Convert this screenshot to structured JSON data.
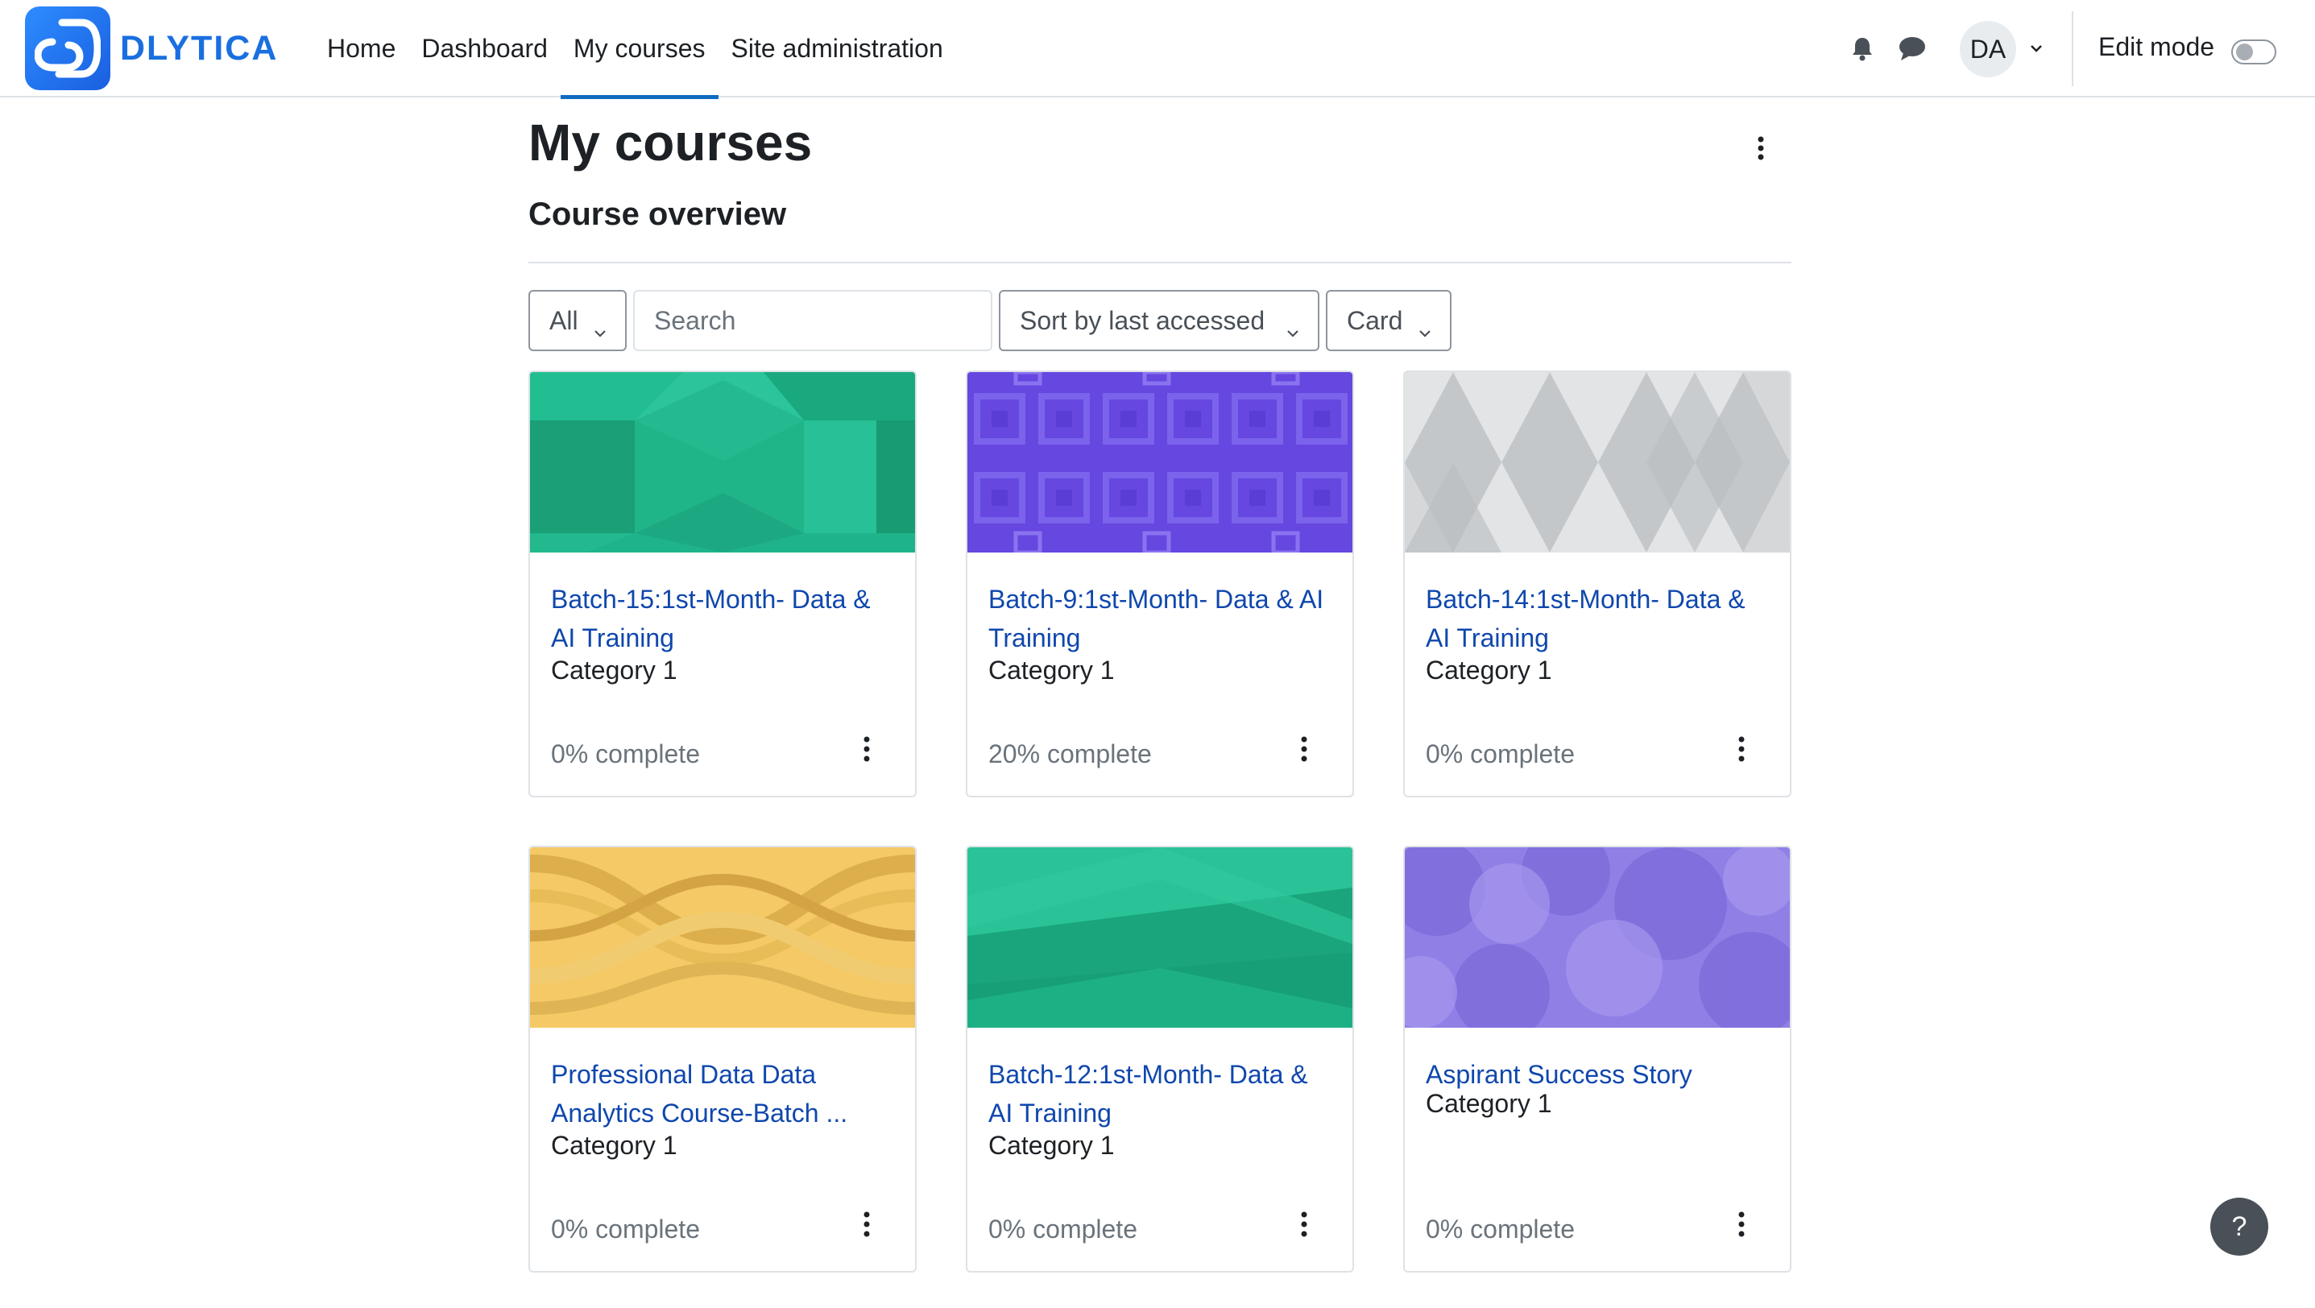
{
  "brand": {
    "name": "DLYTICA",
    "accent": "#1a6fe0"
  },
  "nav": {
    "items": [
      {
        "label": "Home"
      },
      {
        "label": "Dashboard"
      },
      {
        "label": "My courses",
        "active": true
      },
      {
        "label": "Site administration"
      }
    ],
    "icons": [
      "bell-icon",
      "chat-icon"
    ],
    "user_initials": "DA",
    "edit_mode_label": "Edit mode",
    "edit_mode_on": false
  },
  "page": {
    "title": "My courses",
    "section_title": "Course overview"
  },
  "filters": {
    "grouping": "All",
    "search_placeholder": "Search",
    "sort": "Sort by last accessed",
    "view": "Card"
  },
  "courses": [
    {
      "title": "Batch-15:1st-Month- Data & AI Training",
      "category": "Category 1",
      "progress": "0% complete",
      "pattern": "green-hexagon"
    },
    {
      "title": "Batch-9:1st-Month- Data & AI Training",
      "category": "Category 1",
      "progress": "20% complete",
      "pattern": "purple-squares"
    },
    {
      "title": "Batch-14:1st-Month- Data & AI Training",
      "category": "Category 1",
      "progress": "0% complete",
      "pattern": "grey-diamonds"
    },
    {
      "title": "Professional Data Data Analytics Course-Batch ...",
      "category": "Category 1",
      "progress": "0% complete",
      "pattern": "yellow-waves"
    },
    {
      "title": "Batch-12:1st-Month- Data & AI Training",
      "category": "Category 1",
      "progress": "0% complete",
      "pattern": "green-triangles"
    },
    {
      "title": "Aspirant Success Story",
      "category": "Category 1",
      "progress": "0% complete",
      "pattern": "purple-circles"
    }
  ],
  "help_label": "?"
}
